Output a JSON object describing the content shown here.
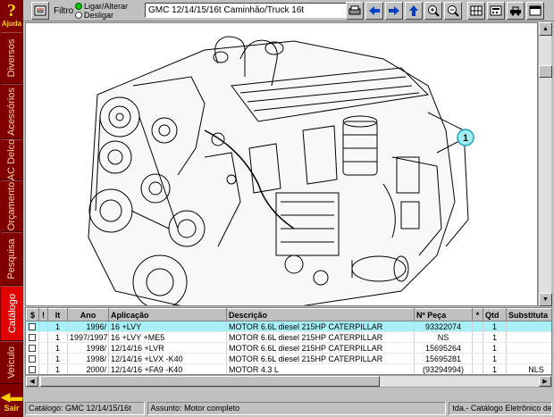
{
  "sidebar": {
    "help_label": "Ajuda",
    "tabs": [
      "Diversos",
      "Acessórios",
      "AC Delco",
      "Orçamento",
      "Pesquisa",
      "Catálogo",
      "Veículo"
    ],
    "active_tab": "Catálogo",
    "exit_label": "Sair"
  },
  "toolbar": {
    "filter_label": "Filtro",
    "radio_on_label": "Ligar/Alterar",
    "radio_off_label": "Desligar",
    "vehicle_title": "GMC 12/14/15/16t Caminhão/Truck 16t"
  },
  "picture": {
    "callout_number": "1"
  },
  "table": {
    "headers": [
      "$",
      "!",
      "It",
      "Ano",
      "Aplicação",
      "Descrição",
      "Nº Peça",
      "*",
      "Qtd",
      "Substituta"
    ],
    "rows": [
      {
        "it": "1",
        "ano": "1996/",
        "aplicacao": "16 +LVY",
        "descricao": "MOTOR 6.6L diesel 215HP CATERPILLAR",
        "peca": "93322074",
        "qtd": "1",
        "substituta": ""
      },
      {
        "it": "1",
        "ano": "1997/1997",
        "aplicacao": "16 +LVY +ME5",
        "descricao": "MOTOR 6.6L diesel 215HP CATERPILLAR",
        "peca": "NS",
        "qtd": "1",
        "substituta": ""
      },
      {
        "it": "1",
        "ano": "1998/",
        "aplicacao": "12/14/16 +LVR",
        "descricao": "MOTOR 6.6L diesel 215HP CATERPILLAR",
        "peca": "15695264",
        "qtd": "1",
        "substituta": ""
      },
      {
        "it": "1",
        "ano": "1998/",
        "aplicacao": "12/14/16 +LVX -K40",
        "descricao": "MOTOR 6.6L diesel 215HP CATERPILLAR",
        "peca": "15695281",
        "qtd": "1",
        "substituta": ""
      },
      {
        "it": "1",
        "ano": "2000/",
        "aplicacao": "12/14/16 +FA9 -K40",
        "descricao": "MOTOR 4.3 L",
        "peca": "(93294994)",
        "qtd": "1",
        "substituta": "NLS"
      }
    ],
    "selected_row": 0
  },
  "status": {
    "catalog": "Catálogo: GMC 12/14/15/16t",
    "subject": "Assunto: Motor completo",
    "app": "tda.- Catálogo Eletrônico de Pe"
  }
}
